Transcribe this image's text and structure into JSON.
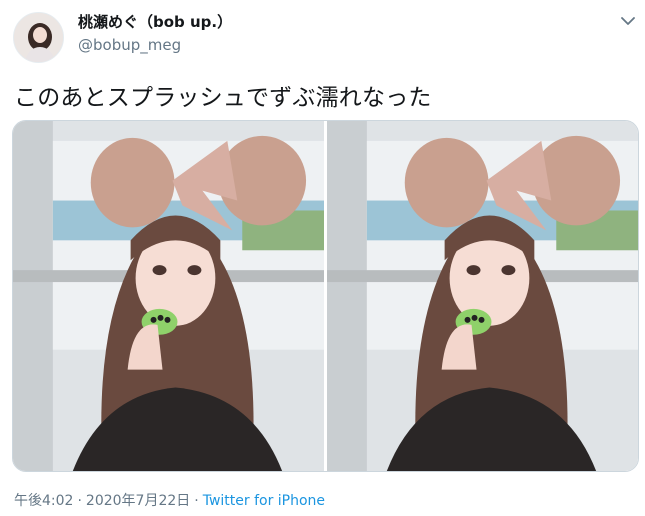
{
  "tweet": {
    "author": {
      "display_name": "桃瀬めぐ（bob up.）",
      "handle": "@bobup_meg"
    },
    "text": "このあとスプラッシュでずぶ濡れなった",
    "media_count": 2,
    "footer": {
      "time": "午後4:02",
      "date": "2020年7月22日",
      "separator": "·",
      "source": "Twitter for iPhone"
    }
  },
  "icons": {
    "menu": "chevron-down-icon"
  },
  "colors": {
    "text_primary": "#14171a",
    "text_secondary": "#657786",
    "link": "#1b95e0",
    "border": "#ccd6dd"
  }
}
